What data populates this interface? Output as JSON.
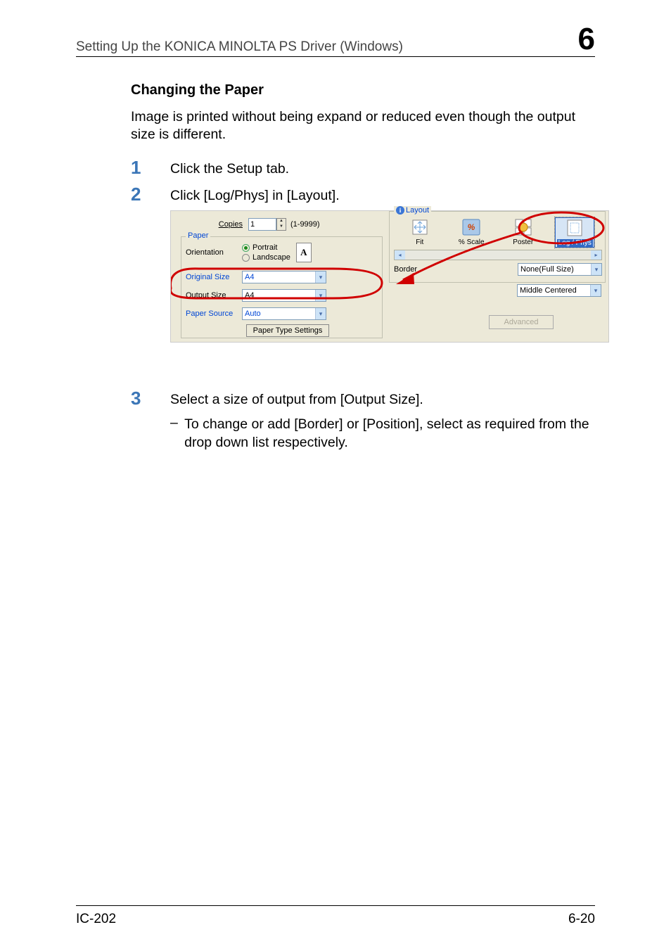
{
  "header": {
    "title": "Setting Up the KONICA MINOLTA PS Driver (Windows)",
    "chapter": "6"
  },
  "section": {
    "heading": "Changing the Paper",
    "intro": "Image is printed without being expand or reduced even though the output size is different."
  },
  "steps": {
    "s1_num": "1",
    "s1_text": "Click the Setup tab.",
    "s2_num": "2",
    "s2_text": "Click [Log/Phys] in [Layout].",
    "s3_num": "3",
    "s3_text": "Select a size of output from [Output Size].",
    "s3_sub_dash": "–",
    "s3_sub_text": "To change or add [Border] or [Position], select as required from the drop down list respectively."
  },
  "dialog": {
    "copies_label": "Copies",
    "copies_value": "1",
    "copies_range": "(1-9999)",
    "paper_legend": "Paper",
    "orientation_label": "Orientation",
    "portrait": "Portrait",
    "landscape": "Landscape",
    "orient_glyph": "A",
    "original_size_label": "Original Size",
    "original_size_value": "A4",
    "output_size_label": "Output Size",
    "output_size_value": "A4",
    "paper_source_label": "Paper Source",
    "paper_source_value": "Auto",
    "paper_type_settings": "Paper Type Settings",
    "layout_legend": "Layout",
    "layout_fit": "Fit",
    "layout_scale": "% Scale",
    "layout_poster": "Poster",
    "layout_logphys": "Log / Phys",
    "border_label": "Border",
    "border_value": "None(Full Size)",
    "position_value": "Middle Centered",
    "advanced": "Advanced"
  },
  "footer": {
    "left": "IC-202",
    "right": "6-20"
  }
}
